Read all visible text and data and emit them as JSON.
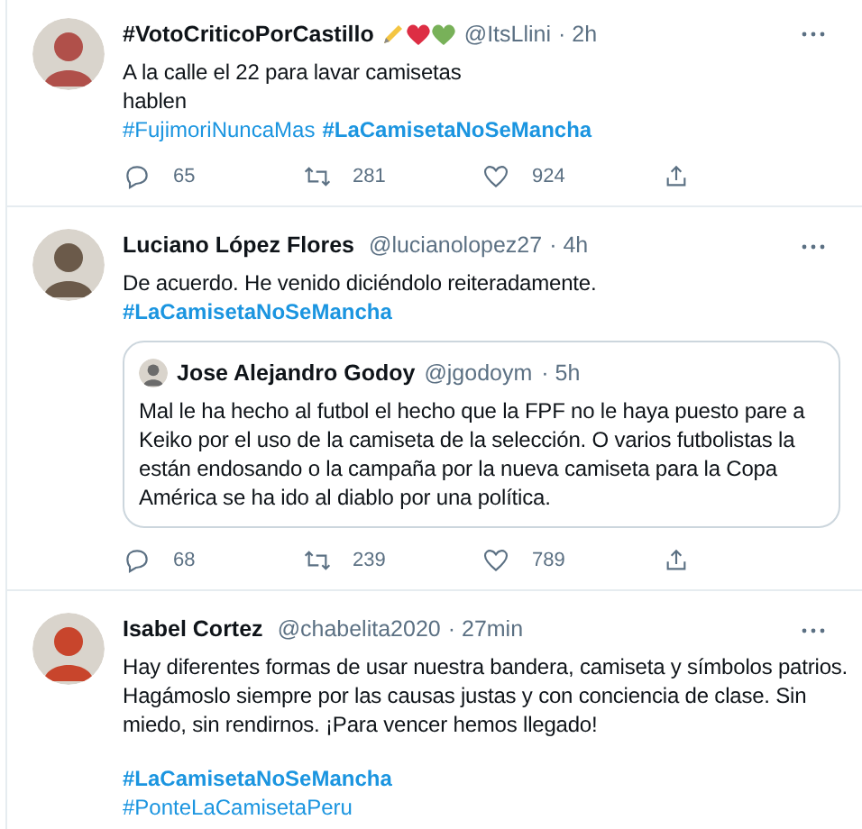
{
  "tweets": [
    {
      "name": "#VotoCriticoPorCastillo",
      "emojis": [
        {
          "kind": "pencil"
        },
        {
          "kind": "heart",
          "color": "#dd2e44"
        },
        {
          "kind": "heart",
          "color": "#78b159"
        }
      ],
      "handle": "@ItsLlini",
      "time": "· 2h",
      "lines": [
        "A la calle el 22 para lavar camisetas",
        "hablen"
      ],
      "hashtag_lines": [
        [
          {
            "text": "#FujimoriNuncaMas",
            "bold": false
          },
          {
            "text": "#LaCamisetaNoSeMancha",
            "bold": true
          }
        ]
      ],
      "actions": {
        "replies": "65",
        "retweets": "281",
        "likes": "924"
      }
    },
    {
      "name": "Luciano López Flores",
      "handle": "@lucianolopez27",
      "time": "· 4h",
      "lines": [
        "De acuerdo. He venido diciéndolo reiteradamente."
      ],
      "hashtag_lines": [
        [
          {
            "text": "#LaCamisetaNoSeMancha",
            "bold": true
          }
        ]
      ],
      "quote": {
        "name": "Jose Alejandro Godoy",
        "handle": "@jgodoym",
        "time": "· 5h",
        "lines": [
          "Mal le ha hecho al futbol el hecho que la FPF no le haya puesto pare a",
          "Keiko por el uso de la camiseta de la selección. O varios futbolistas la",
          "están endosando o la campaña por la nueva camiseta para la Copa",
          "América se ha ido al diablo por una política."
        ]
      },
      "actions": {
        "replies": "68",
        "retweets": "239",
        "likes": "789"
      }
    },
    {
      "name": "Isabel Cortez",
      "handle": "@chabelita2020",
      "time": "· 27min",
      "lines": [
        "Hay diferentes formas de usar nuestra bandera, camiseta y símbolos patrios.",
        "Hagámoslo siempre por las causas justas y con conciencia de clase. Sin",
        "miedo, sin rendirnos. ¡Para vencer hemos llegado!"
      ],
      "hashtag_lines": [
        [
          {
            "text": "#LaCamisetaNoSeMancha",
            "bold": true
          }
        ],
        [
          {
            "text": "#PonteLaCamisetaPeru",
            "bold": false
          }
        ]
      ]
    }
  ]
}
